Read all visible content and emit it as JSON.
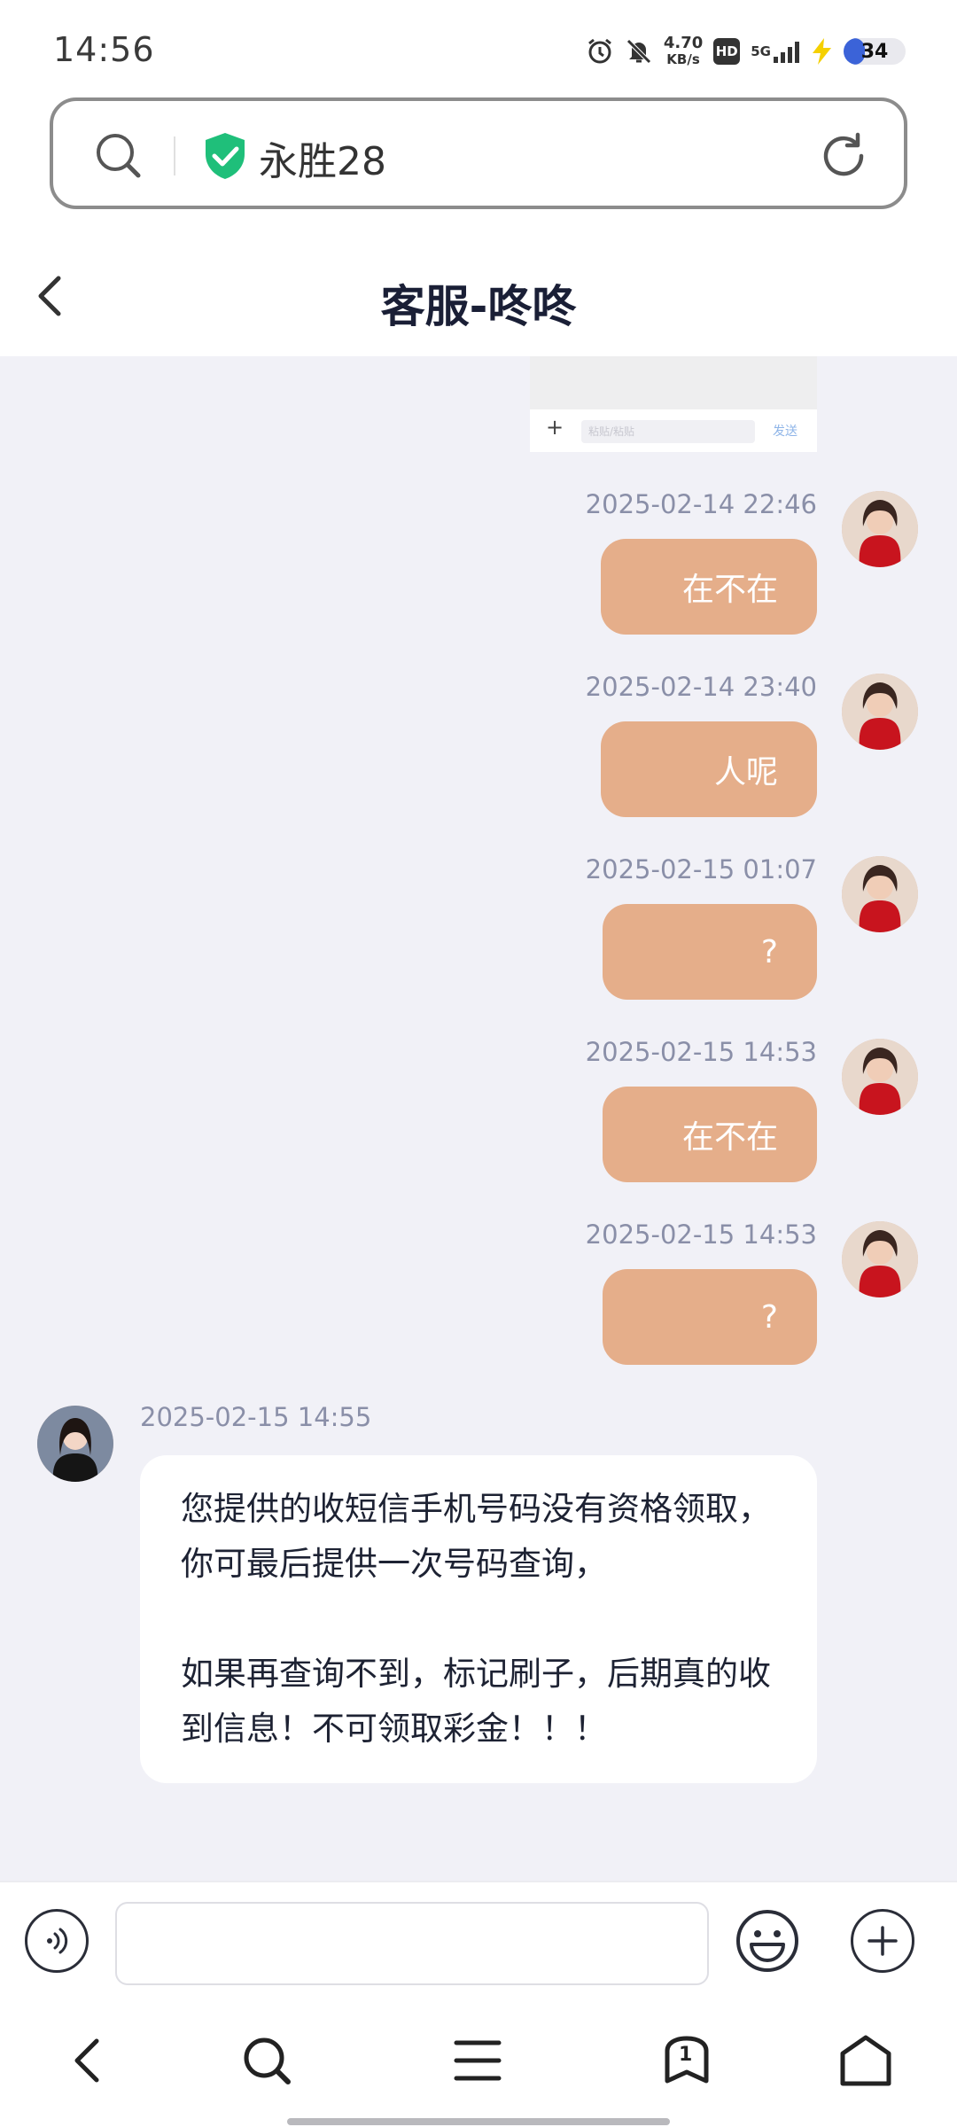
{
  "status_bar": {
    "time": "14:56",
    "net_speed_value": "4.70",
    "net_speed_unit": "KB/s",
    "hd": "HD",
    "network": "5G",
    "battery": "34",
    "battery_level": 0.34,
    "icons": [
      "alarm-icon",
      "mute-icon",
      "signal-icon",
      "charging-icon"
    ]
  },
  "address_bar": {
    "site_name": "永胜28",
    "icons": [
      "search-icon",
      "shield-check-icon",
      "refresh-icon"
    ],
    "shield_color": "#1fbf7a"
  },
  "chat": {
    "title": "客服-咚咚",
    "preview": {
      "placeholder": "粘贴/粘贴",
      "send": "发送"
    },
    "messages": [
      {
        "side": "out",
        "time": "2025-02-14 22:46",
        "text": "在不在"
      },
      {
        "side": "out",
        "time": "2025-02-14 23:40",
        "text": "人呢"
      },
      {
        "side": "out",
        "time": "2025-02-15 01:07",
        "text": "?"
      },
      {
        "side": "out",
        "time": "2025-02-15 14:53",
        "text": "在不在"
      },
      {
        "side": "out",
        "time": "2025-02-15 14:53",
        "text": "?"
      },
      {
        "side": "in",
        "time": "2025-02-15 14:55",
        "text": "您提供的收短信手机号码没有资格领取，你可最后提供一次号码查询，\n\n如果再查询不到，标记刷子，后期真的收到信息！不可领取彩金！！！"
      }
    ],
    "colors": {
      "out_bubble": "#e5ae8a",
      "in_bubble": "#ffffff",
      "background": "#f1f1f7"
    }
  },
  "input_bar": {
    "value": "",
    "icons": [
      "voice-icon",
      "emoji-icon",
      "plus-icon"
    ]
  },
  "browser_nav": {
    "tab_count": "1",
    "icons": [
      "back-icon",
      "search-icon",
      "menu-icon",
      "tabs-icon",
      "home-icon"
    ]
  }
}
